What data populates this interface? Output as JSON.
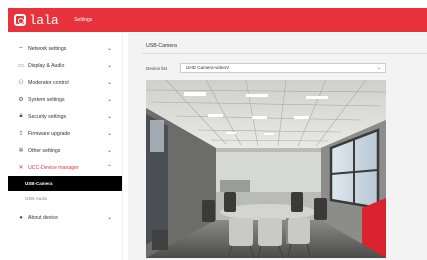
{
  "app": {
    "logo_text": "lala",
    "page_title": "Settings"
  },
  "sidebar": {
    "items": [
      {
        "label": "Network settings",
        "icon": "wifi-icon"
      },
      {
        "label": "Display & Audio",
        "icon": "monitor-icon"
      },
      {
        "label": "Moderator control",
        "icon": "moderator-icon"
      },
      {
        "label": "System settings",
        "icon": "gear-icon"
      },
      {
        "label": "Security settings",
        "icon": "lock-icon"
      },
      {
        "label": "Firmware upgrade",
        "icon": "upload-icon"
      },
      {
        "label": "Other settings",
        "icon": "settings-icon"
      },
      {
        "label": "UCC-Device manager",
        "icon": "tools-icon",
        "active": true
      }
    ],
    "sub_items": [
      {
        "label": "USB-Camera",
        "selected": true
      },
      {
        "label": "USB-Audio",
        "selected": false
      }
    ],
    "about": {
      "label": "About device",
      "icon": "info-icon"
    }
  },
  "main": {
    "title": "USB-Camera",
    "device_label": "Device list",
    "device_value": "UHD Camera-videoV",
    "accent_color": "#e8333d"
  }
}
